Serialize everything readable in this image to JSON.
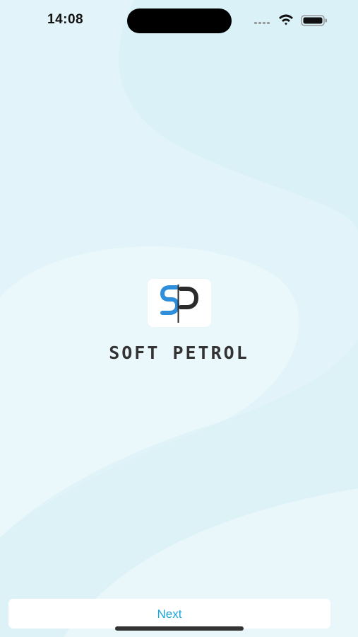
{
  "status_bar": {
    "time": "14:08",
    "icons": [
      "cellular-signal-icon",
      "wifi-icon",
      "battery-icon"
    ]
  },
  "logo": {
    "icon": "soft-petrol-sp-logo",
    "brand_name": "SOFT PETROL",
    "colors": {
      "s_blue": "#2d8fdc",
      "p_dark": "#2b2b2b"
    }
  },
  "footer": {
    "next_label": "Next"
  },
  "colors": {
    "background": "#e3f5fa",
    "wave_light": "#eef9fc",
    "wave_dark": "#d6f0f7",
    "accent": "#1aa3d6"
  }
}
